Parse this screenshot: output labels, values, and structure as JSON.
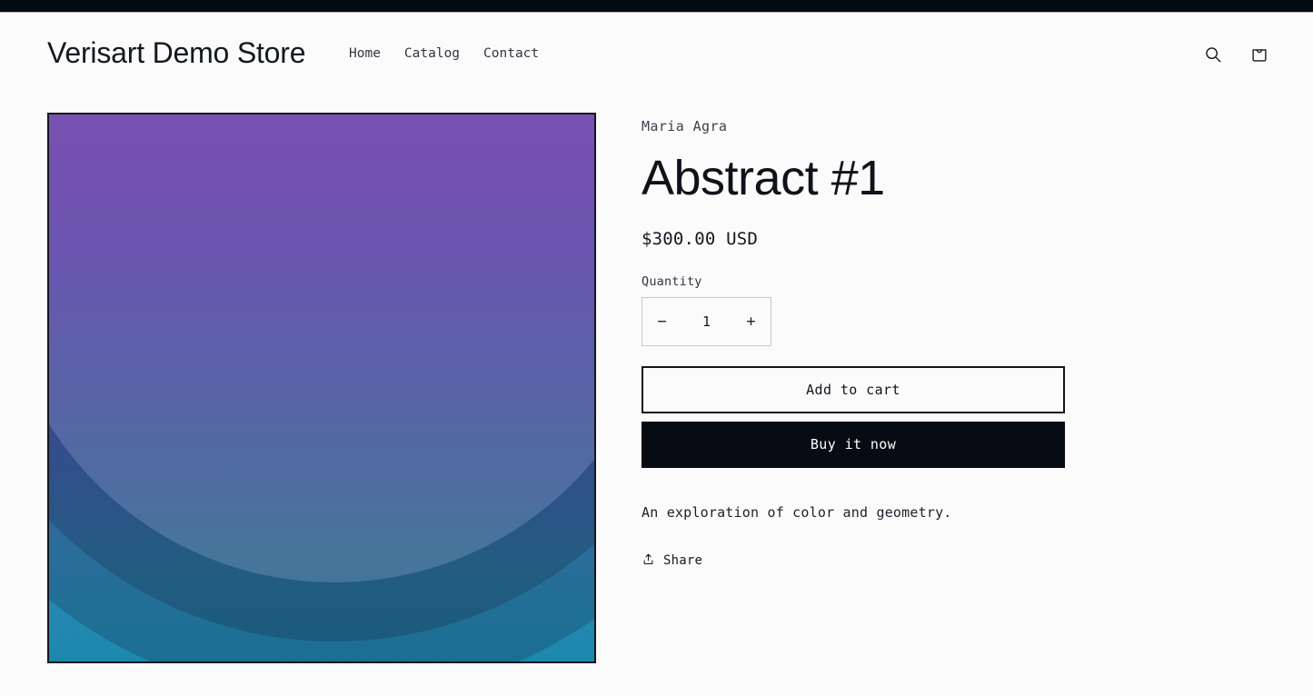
{
  "announcement_bar": {
    "text": ""
  },
  "header": {
    "brand": "Verisart Demo Store",
    "nav": [
      {
        "label": "Home"
      },
      {
        "label": "Catalog"
      },
      {
        "label": "Contact"
      }
    ],
    "actions": {
      "search_icon": "search-icon",
      "cart_icon": "shopping-bag-icon"
    }
  },
  "product": {
    "vendor": "Maria Agra",
    "title": "Abstract #1",
    "price": "$300.00 USD",
    "quantity": {
      "label": "Quantity",
      "decrease": "−",
      "value": "1",
      "increase": "+"
    },
    "add_to_cart_label": "Add to cart",
    "buy_now_label": "Buy it now",
    "description": "An exploration of color and geometry.",
    "share_label": "Share",
    "media": {
      "alt": "Abstract #1 artwork",
      "gradient_top": "#8e45e3",
      "gradient_mid": "#5a5fd3",
      "gradient_bottom": "#1c88ac",
      "ring_overlay": "rgba(18, 14, 40, 0.20)",
      "inner_circle_overlay": "rgba(210, 220, 255, 0.20)",
      "border_color": "#15171c"
    }
  },
  "theme": {
    "background": "#fbfbfc",
    "text": "#14181f",
    "accent_dark": "#070c14"
  }
}
